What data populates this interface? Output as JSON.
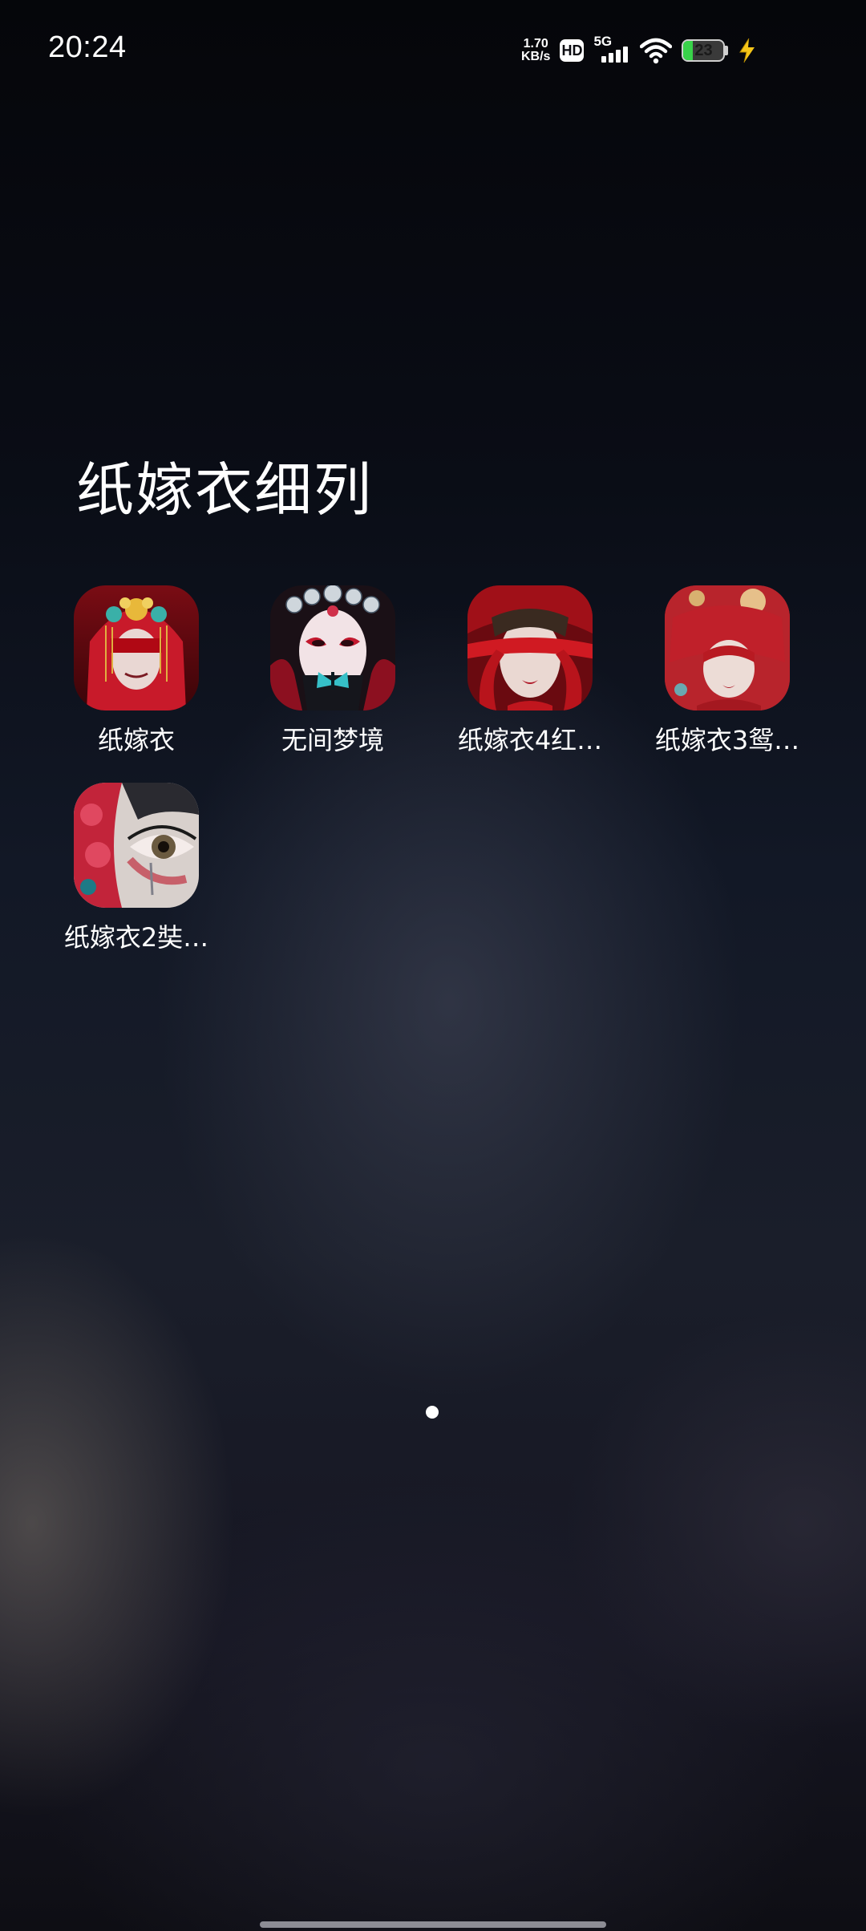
{
  "status_bar": {
    "time": "20:24",
    "net_speed_value": "1.70",
    "net_speed_unit": "KB/s",
    "hd_label": "HD",
    "network_label": "5G",
    "battery_level": "23",
    "battery_fraction": 0.23,
    "icons": [
      "hd-icon",
      "signal-5g-icon",
      "wifi-icon",
      "battery-icon",
      "charging-bolt-icon"
    ]
  },
  "folder": {
    "title": "纸嫁衣细列",
    "apps": [
      {
        "label": "纸嫁衣",
        "icon": "bride-red-veil-icon"
      },
      {
        "label": "无间梦境",
        "icon": "opera-mask-butterfly-icon"
      },
      {
        "label": "纸嫁衣4红…",
        "icon": "blindfolded-woman-icon"
      },
      {
        "label": "纸嫁衣3鸳…",
        "icon": "red-veil-woman-icon"
      },
      {
        "label": "纸嫁衣2奘…",
        "icon": "painted-face-eye-icon"
      }
    ]
  },
  "pager": {
    "pages": 1,
    "current": 1
  },
  "colors": {
    "background": "#07080c",
    "text": "#ffffff",
    "battery_fill": "#39d24a",
    "charging_bolt": "#f5c518"
  }
}
